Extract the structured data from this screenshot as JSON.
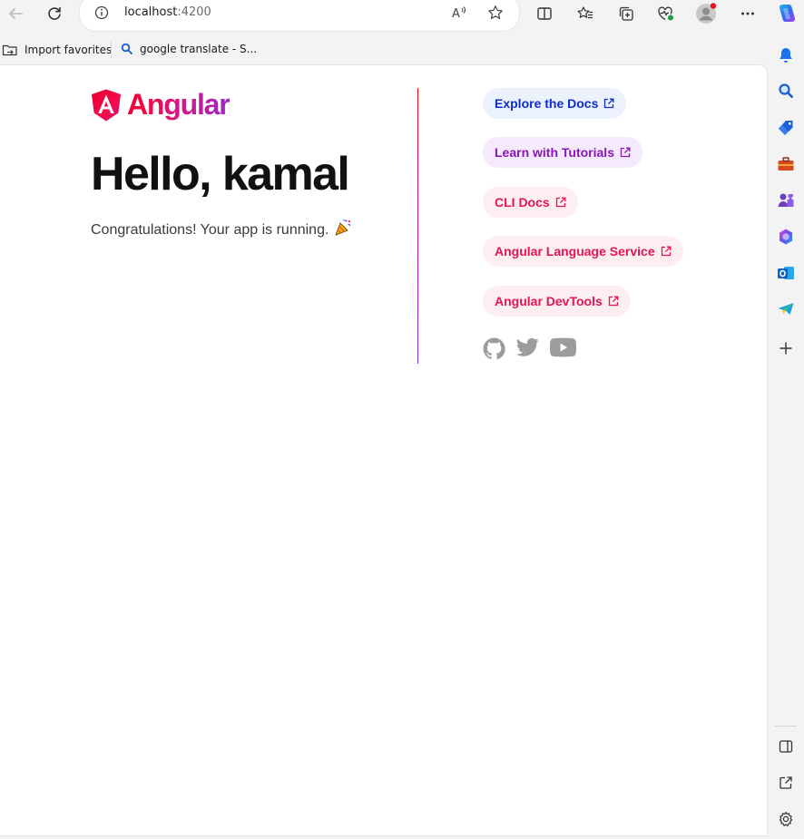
{
  "browser": {
    "address_host": "localhost",
    "address_port": ":4200",
    "icons": [
      "back-icon",
      "refresh-icon",
      "site-info-icon",
      "read-aloud-icon",
      "favorite-star-icon",
      "split-screen-icon",
      "favorites-icon",
      "collections-icon",
      "browser-essentials-icon",
      "profile-avatar-icon",
      "more-menu-icon",
      "copilot-icon"
    ]
  },
  "favorites_bar": {
    "items": [
      {
        "label": "Import favorites",
        "icon": "import-folder-icon"
      },
      {
        "label": "google translate - S...",
        "icon": "search-icon"
      }
    ]
  },
  "page": {
    "logo_text": "Angular",
    "heading": "Hello, kamal",
    "subtitle": "Congratulations! Your app is running.",
    "subtitle_emoji": "🎉",
    "links": [
      {
        "label": "Explore the Docs",
        "color": "#0b2ecc",
        "bg": "#ecf1fe"
      },
      {
        "label": "Learn with Tutorials",
        "color": "#8a16b8",
        "bg": "#f5eafb"
      },
      {
        "label": "CLI Docs",
        "color": "#e4154f",
        "bg": "#fdeef2"
      },
      {
        "label": "Angular Language Service",
        "color": "#e4154f",
        "bg": "#fdeef2"
      },
      {
        "label": "Angular DevTools",
        "color": "#e4154f",
        "bg": "#fdeef2"
      }
    ],
    "social": [
      "github-icon",
      "twitter-icon",
      "youtube-icon"
    ],
    "colors": {
      "social_icon": "#9c9c9c",
      "divider_top": "#f0060b",
      "divider_bottom": "#7b2ff7"
    }
  },
  "sidebar": {
    "icons": [
      "notifications-icon",
      "search-icon",
      "shopping-tag-icon",
      "tools-briefcase-icon",
      "games-icon",
      "microsoft-365-icon",
      "outlook-icon",
      "send-drop-icon",
      "add-icon",
      "hide-sidebar-icon",
      "external-link-icon",
      "settings-gear-icon"
    ]
  }
}
